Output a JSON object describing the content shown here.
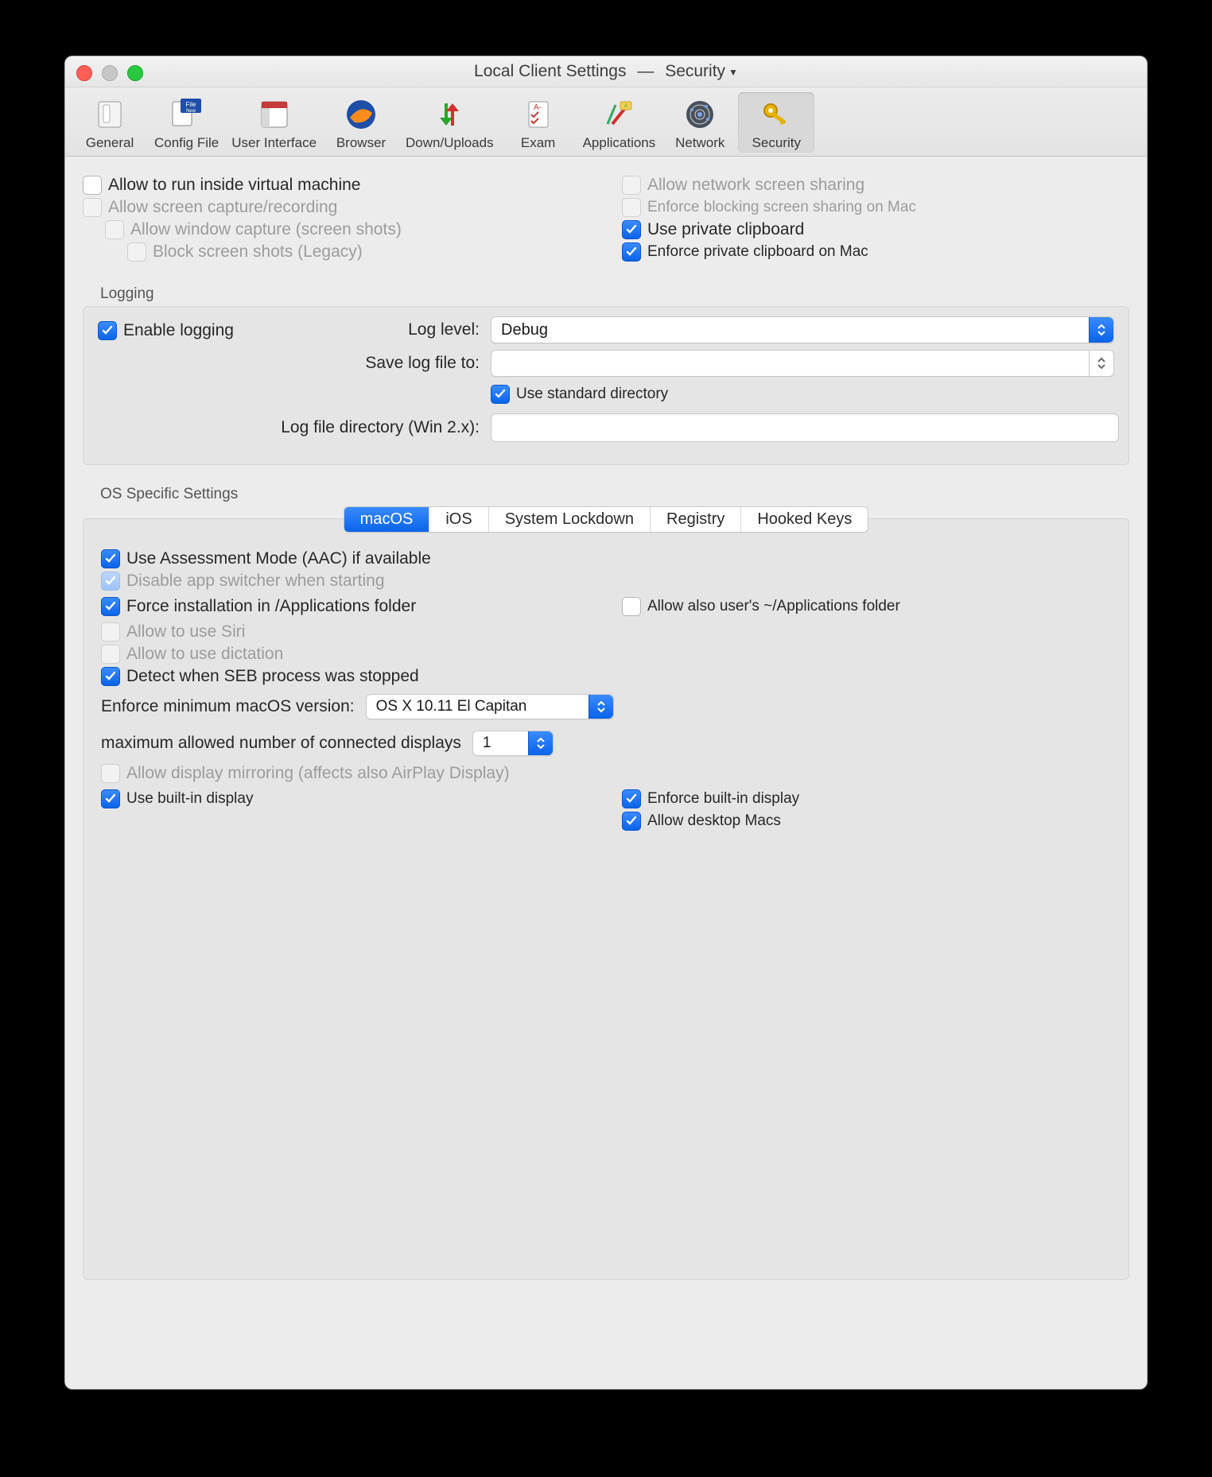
{
  "window": {
    "title_left": "Local Client Settings",
    "title_sep": "—",
    "title_right": "Security"
  },
  "toolbar": {
    "items": [
      {
        "id": "general",
        "label": "General"
      },
      {
        "id": "config",
        "label": "Config File"
      },
      {
        "id": "ui",
        "label": "User Interface"
      },
      {
        "id": "browser",
        "label": "Browser"
      },
      {
        "id": "updown",
        "label": "Down/Uploads"
      },
      {
        "id": "exam",
        "label": "Exam"
      },
      {
        "id": "apps",
        "label": "Applications"
      },
      {
        "id": "network",
        "label": "Network"
      },
      {
        "id": "security",
        "label": "Security"
      }
    ],
    "active": "security"
  },
  "top": {
    "left": {
      "allow_vm": "Allow to run inside virtual machine",
      "allow_capture": "Allow screen capture/recording",
      "allow_window_capture": "Allow window capture (screen shots)",
      "block_shots": "Block screen shots (Legacy)"
    },
    "right": {
      "allow_net_share": "Allow network screen sharing",
      "enforce_block_share": "Enforce blocking screen sharing on Mac",
      "use_private_clip": "Use private clipboard",
      "enforce_private_clip": "Enforce private clipboard on Mac"
    }
  },
  "logging": {
    "title": "Logging",
    "enable": "Enable logging",
    "loglevel_label": "Log level:",
    "loglevel_value": "Debug",
    "save_to_label": "Save log file to:",
    "save_to_value": "",
    "use_std_dir": "Use standard directory",
    "win_dir_label": "Log file directory (Win 2.x):",
    "win_dir_value": ""
  },
  "os": {
    "title": "OS Specific Settings",
    "tabs": [
      "macOS",
      "iOS",
      "System Lockdown",
      "Registry",
      "Hooked Keys"
    ],
    "active_tab": "macOS",
    "mac": {
      "use_aac": "Use Assessment Mode (AAC) if available",
      "disable_switcher": "Disable app switcher when starting",
      "force_install": "Force installation in /Applications folder",
      "allow_user_apps": "Allow also user's ~/Applications folder",
      "allow_siri": "Allow to use Siri",
      "allow_dictation": "Allow to use dictation",
      "detect_stop": "Detect when SEB process was stopped",
      "min_macos_label": "Enforce minimum macOS version:",
      "min_macos_value": "OS X 10.11 El Capitan",
      "max_displays_label": "maximum allowed number of connected displays",
      "max_displays_value": "1",
      "allow_mirror": "Allow display mirroring (affects also AirPlay Display)",
      "use_builtin": "Use built-in display",
      "enforce_builtin": "Enforce built-in display",
      "allow_desktop_mac": "Allow desktop Macs"
    }
  }
}
